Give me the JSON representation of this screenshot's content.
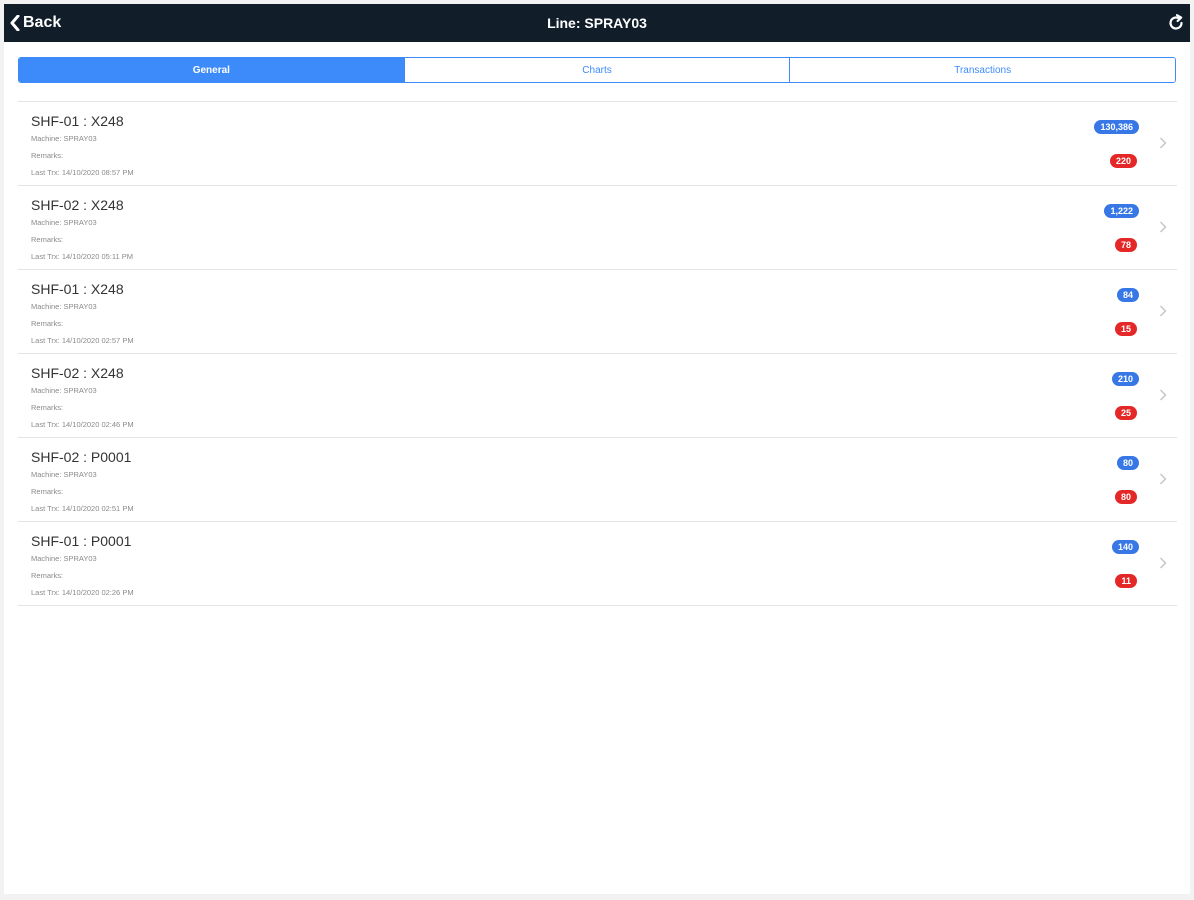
{
  "navbar": {
    "back_label": "Back",
    "title": "Line: SPRAY03"
  },
  "tabs": [
    {
      "label": "General",
      "active": true
    },
    {
      "label": "Charts",
      "active": false
    },
    {
      "label": "Transactions",
      "active": false
    }
  ],
  "rows": [
    {
      "title": "SHF-01 : X248",
      "machine": "Machine: SPRAY03",
      "remarks": "Remarks:",
      "last_trx": "Last Trx: 14/10/2020 08:57 PM",
      "count_blue": "130,386",
      "count_red": "220"
    },
    {
      "title": "SHF-02 : X248",
      "machine": "Machine: SPRAY03",
      "remarks": "Remarks:",
      "last_trx": "Last Trx: 14/10/2020 05:11 PM",
      "count_blue": "1,222",
      "count_red": "78"
    },
    {
      "title": "SHF-01 : X248",
      "machine": "Machine: SPRAY03",
      "remarks": "Remarks:",
      "last_trx": "Last Trx: 14/10/2020 02:57 PM",
      "count_blue": "84",
      "count_red": "15"
    },
    {
      "title": "SHF-02 : X248",
      "machine": "Machine: SPRAY03",
      "remarks": "Remarks:",
      "last_trx": "Last Trx: 14/10/2020 02:46 PM",
      "count_blue": "210",
      "count_red": "25"
    },
    {
      "title": "SHF-02 : P0001",
      "machine": "Machine: SPRAY03",
      "remarks": "Remarks:",
      "last_trx": "Last Trx: 14/10/2020 02:51 PM",
      "count_blue": "80",
      "count_red": "80"
    },
    {
      "title": "SHF-01 : P0001",
      "machine": "Machine: SPRAY03",
      "remarks": "Remarks:",
      "last_trx": "Last Trx: 14/10/2020 02:26 PM",
      "count_blue": "140",
      "count_red": "11"
    }
  ],
  "colors": {
    "navbar_bg": "#111d29",
    "accent": "#3d8bfb",
    "badge_blue": "#3778e6",
    "badge_red": "#e42828"
  },
  "icons": {
    "back": "chevron-left-icon",
    "refresh": "refresh-icon",
    "row_disclosure": "chevron-right-icon"
  }
}
